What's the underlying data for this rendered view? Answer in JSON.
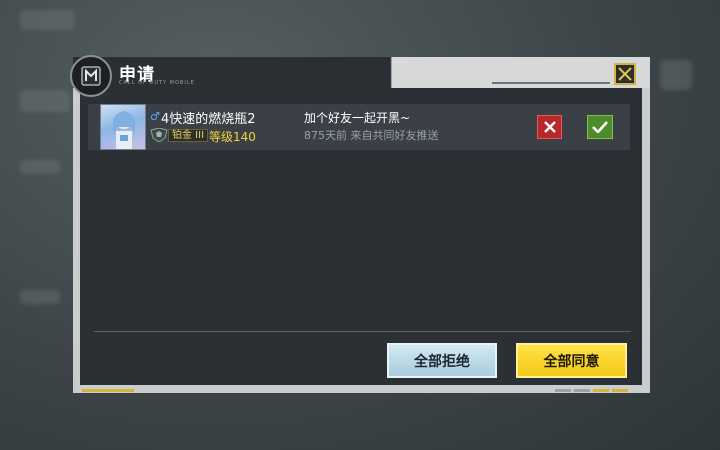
{
  "dialog": {
    "title": "申请",
    "subtitle": "CALL OF DUTY MOBILE",
    "close_icon": "close-x-icon"
  },
  "request": {
    "player_name": "4快速的燃烧瓶2",
    "gender_icon": "male-icon",
    "rank": "铂金 III",
    "level": "等级140",
    "message": "加个好友一起开黑~",
    "meta": "875天前 来自共同好友推送",
    "reject_icon": "x-icon",
    "accept_icon": "checkmark-icon"
  },
  "actions": {
    "reject_all": "全部拒绝",
    "accept_all": "全部同意"
  },
  "colors": {
    "accent_yellow": "#f2c817",
    "reject_red": "#b8282a",
    "accept_green": "#4d8b2b",
    "panel_dark": "#2b3035"
  }
}
